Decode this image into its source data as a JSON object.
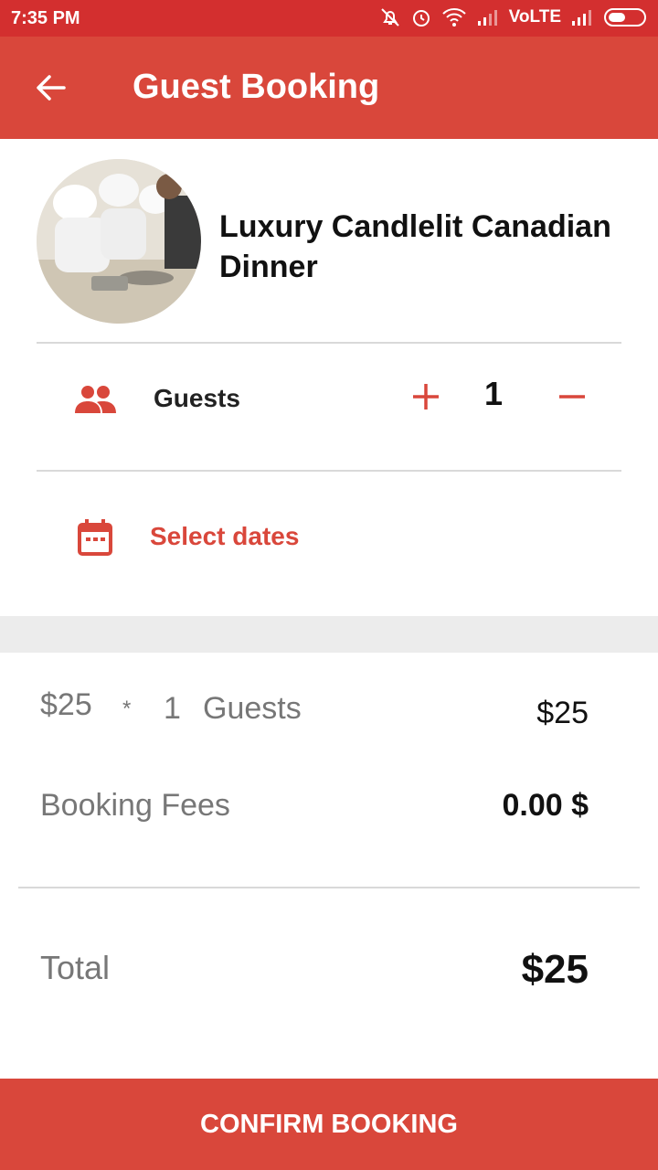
{
  "status_bar": {
    "time": "7:35 PM",
    "network": "VoLTE",
    "icons": [
      "mute-icon",
      "alarm-icon",
      "wifi-icon",
      "signal-icon",
      "battery-icon"
    ]
  },
  "app_bar": {
    "title": "Guest Booking",
    "back_icon": "arrow-back-icon"
  },
  "event": {
    "title": "Luxury Candlelit Canadian Dinner",
    "image": "chefs-cooking-photo"
  },
  "guests": {
    "label": "Guests",
    "count": "1",
    "icon": "people-icon"
  },
  "dates": {
    "label": "Select dates",
    "icon": "calendar-icon"
  },
  "summary": {
    "price_each": "$25",
    "multiply_sign": "*",
    "quantity": "1",
    "guests_word": "Guests",
    "subtotal": "$25",
    "fees_label": "Booking Fees",
    "fees_value": "0.00 $",
    "total_label": "Total",
    "total_value": "$25"
  },
  "actions": {
    "confirm_label": "CONFIRM BOOKING"
  },
  "colors": {
    "status_bar": "#d32f2f",
    "accent": "#d9473b",
    "band": "#ececec"
  }
}
